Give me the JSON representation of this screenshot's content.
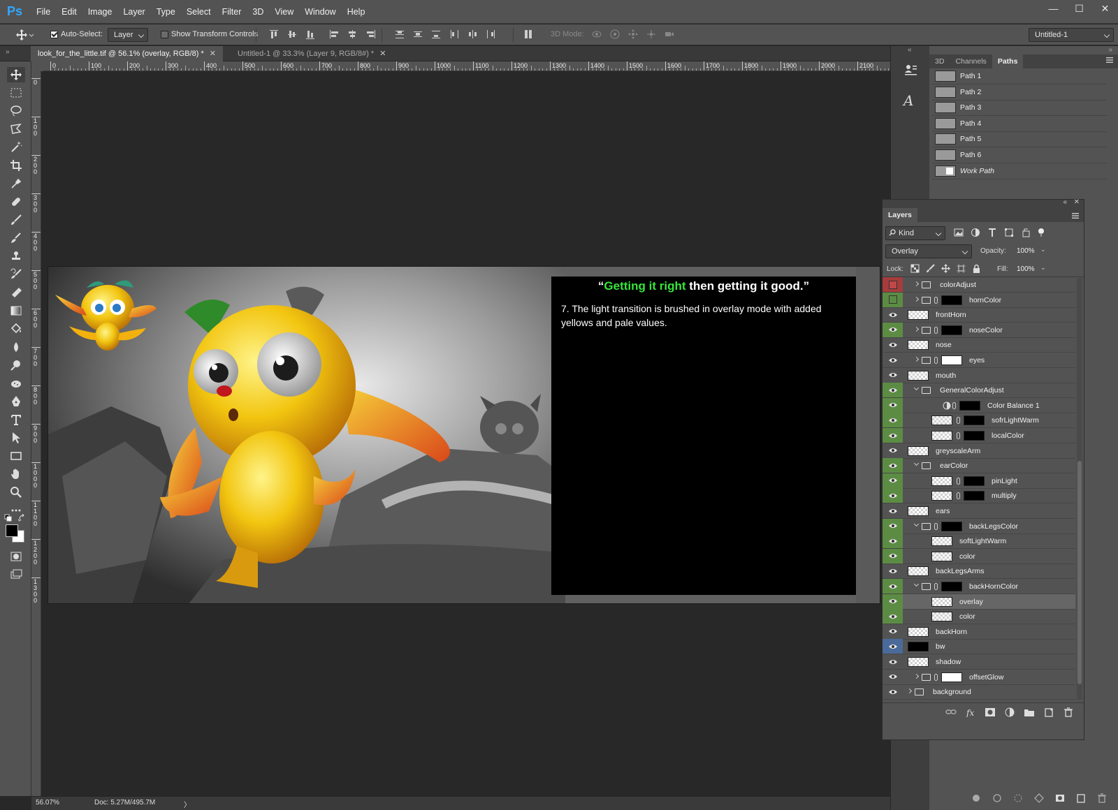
{
  "app": {
    "logo": "Ps"
  },
  "menu": [
    "File",
    "Edit",
    "Image",
    "Layer",
    "Type",
    "Select",
    "Filter",
    "3D",
    "View",
    "Window",
    "Help"
  ],
  "window_controls": {
    "minimize": "—",
    "maximize": "☐",
    "close": "✕"
  },
  "options": {
    "auto_select_label": "Auto-Select:",
    "auto_select_checked": true,
    "auto_select_target": "Layer",
    "show_transform_label": "Show Transform Controls",
    "show_transform_checked": false,
    "mode_3d_label": "3D Mode:",
    "workspace": "Untitled-1"
  },
  "tabs": [
    {
      "label": "look_for_the_little.tif @ 56.1% (overlay, RGB/8) *",
      "close": "✕",
      "active": true
    },
    {
      "label": "Untitled-1 @ 33.3% (Layer 9, RGB/8#) *",
      "close": "✕",
      "active": false
    }
  ],
  "ruler_h": [
    "0",
    "100",
    "200",
    "300",
    "400",
    "500",
    "600",
    "700",
    "800",
    "900",
    "1000",
    "1100",
    "1200",
    "1300",
    "1400",
    "1500",
    "1600",
    "1700",
    "1800",
    "1900",
    "2000",
    "2100"
  ],
  "ruler_v": [
    "0",
    "1\n0\n0",
    "2\n0\n0",
    "3\n0\n0",
    "4\n0\n0",
    "5\n0\n0",
    "6\n0\n0",
    "7\n0\n0",
    "8\n0\n0",
    "9\n0\n0",
    "1\n0\n0\n0",
    "1\n1\n0\n0",
    "1\n2\n0\n0",
    "1\n3\n0\n0"
  ],
  "document": {
    "quote_open": "“",
    "quote_green": "Getting it right",
    "quote_rest": " then getting it good.”",
    "caption": "7.  The light transition is brushed in overlay mode with added yellows and pale values.",
    "accent_green": "#35e63a"
  },
  "status": {
    "zoom": "56.07%",
    "doc": "Doc: 5.27M/495.7M",
    "arrow": "〉"
  },
  "paths_panel": {
    "tabs": [
      "3D",
      "Channels",
      "Paths"
    ],
    "active_tab": "Paths",
    "paths": [
      "Path 1",
      "Path 2",
      "Path 3",
      "Path 4",
      "Path 5",
      "Path 6",
      "Work Path"
    ]
  },
  "layers_panel": {
    "title": "Layers",
    "filter": "Kind",
    "blend_mode": "Overlay",
    "opacity_label": "Opacity:",
    "opacity": "100%",
    "lock_label": "Lock:",
    "fill_label": "Fill:",
    "fill": "100%",
    "layers": [
      {
        "name": "colorAdjust",
        "eye": "r",
        "indent": 1,
        "folder": true,
        "arrow": "r",
        "chain": false,
        "mask": false,
        "thumb": false
      },
      {
        "name": "hornColor",
        "eye": "g-empty",
        "indent": 1,
        "folder": true,
        "arrow": "r",
        "chain": true,
        "mask": "black",
        "thumb": false
      },
      {
        "name": "frontHorn",
        "eye": "none",
        "indent": 0,
        "folder": false,
        "thumb": true
      },
      {
        "name": "noseColor",
        "eye": "g",
        "indent": 1,
        "folder": true,
        "arrow": "r",
        "chain": true,
        "mask": "black",
        "thumb": false
      },
      {
        "name": "nose",
        "eye": "none",
        "indent": 0,
        "folder": false,
        "thumb": true
      },
      {
        "name": "eyes",
        "eye": "none",
        "indent": 1,
        "folder": true,
        "arrow": "r",
        "chain": true,
        "mask": "white",
        "thumb": false
      },
      {
        "name": "mouth",
        "eye": "none",
        "indent": 0,
        "folder": false,
        "thumb": true
      },
      {
        "name": "GeneralColorAdjust",
        "eye": "g",
        "indent": 1,
        "folder": true,
        "arrow": "d",
        "chain": false,
        "mask": false,
        "thumb": false
      },
      {
        "name": "Color Balance 1",
        "eye": "g",
        "indent": 2,
        "folder": false,
        "adj": true,
        "chain": true,
        "mask": "black",
        "thumb": false
      },
      {
        "name": "sofrLightWarm",
        "eye": "g",
        "indent": 2,
        "folder": false,
        "chain": true,
        "mask": "black",
        "thumb": true
      },
      {
        "name": "localColor",
        "eye": "g",
        "indent": 2,
        "folder": false,
        "chain": true,
        "mask": "black",
        "thumb": true
      },
      {
        "name": "greyscaleArm",
        "eye": "none",
        "indent": 0,
        "folder": false,
        "thumb": true
      },
      {
        "name": "earColor",
        "eye": "g",
        "indent": 1,
        "folder": true,
        "arrow": "d",
        "chain": false,
        "mask": false,
        "thumb": false
      },
      {
        "name": "pinLight",
        "eye": "g",
        "indent": 2,
        "folder": false,
        "chain": true,
        "mask": "black",
        "thumb": true
      },
      {
        "name": "multiply",
        "eye": "g",
        "indent": 2,
        "folder": false,
        "chain": true,
        "mask": "black",
        "thumb": true
      },
      {
        "name": "ears",
        "eye": "none",
        "indent": 0,
        "folder": false,
        "thumb": true
      },
      {
        "name": "backLegsColor",
        "eye": "g",
        "indent": 1,
        "folder": true,
        "arrow": "d",
        "chain": true,
        "mask": "black",
        "thumb": false
      },
      {
        "name": "softLightWarm",
        "eye": "g",
        "indent": 2,
        "folder": false,
        "thumb": true
      },
      {
        "name": "color",
        "eye": "g",
        "indent": 2,
        "folder": false,
        "thumb": true
      },
      {
        "name": "backLegsArms",
        "eye": "none",
        "indent": 0,
        "folder": false,
        "thumb": true
      },
      {
        "name": "backHornColor",
        "eye": "g",
        "indent": 1,
        "folder": true,
        "arrow": "d",
        "chain": true,
        "mask": "black",
        "thumb": false
      },
      {
        "name": "overlay",
        "eye": "g",
        "indent": 2,
        "folder": false,
        "thumb": true,
        "selected": true
      },
      {
        "name": "color",
        "eye": "g",
        "indent": 2,
        "folder": false,
        "thumb": true
      },
      {
        "name": "backHorn",
        "eye": "none",
        "indent": 0,
        "folder": false,
        "thumb": true
      },
      {
        "name": "bw",
        "eye": "b",
        "indent": 0,
        "folder": false,
        "thumb": "black"
      },
      {
        "name": "shadow",
        "eye": "none",
        "indent": 0,
        "folder": false,
        "thumb": true
      },
      {
        "name": "offsetGlow",
        "eye": "none",
        "indent": 1,
        "folder": true,
        "arrow": "r",
        "chain": true,
        "mask": "white",
        "thumb": false
      },
      {
        "name": "background",
        "eye": "none",
        "indent": -1,
        "folder": true,
        "arrow": "r",
        "chain": false,
        "mask": false,
        "thumb": false
      }
    ]
  },
  "colors": {
    "ui_dark": "#535353",
    "eye_green": "#5c8c44",
    "eye_blue": "#4a6a9a",
    "eye_red": "#a63c3c",
    "ps_blue": "#31a8ff"
  }
}
